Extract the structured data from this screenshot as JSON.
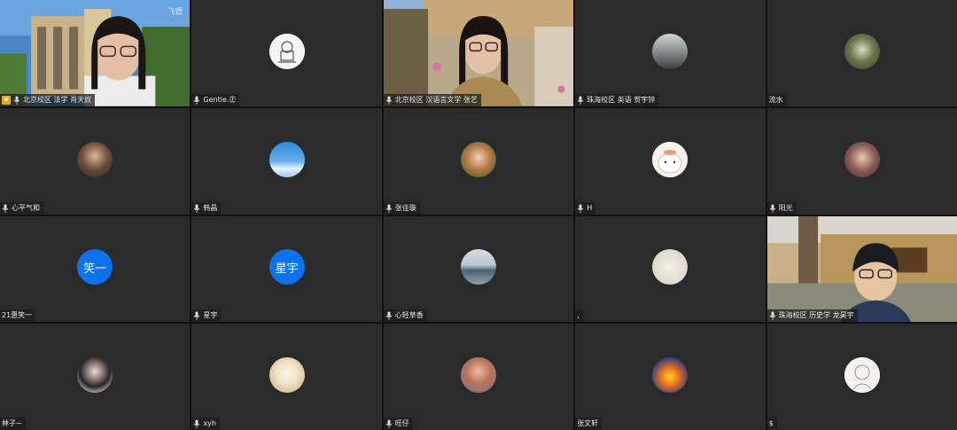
{
  "participants": [
    {
      "name": "北京校区 法学 肖天奴",
      "type": "video",
      "host": true
    },
    {
      "name": "Gentle.㊣",
      "type": "avatar",
      "avatar": "sketch-avatar"
    },
    {
      "name": "北京校区 汉语言文学 张艺",
      "type": "video"
    },
    {
      "name": "珠海校区 英语 贺宇锌",
      "type": "avatar",
      "avatar": "photo-avatar"
    },
    {
      "name": "流水",
      "type": "avatar",
      "avatar": "photo-avatar",
      "no_mic": true
    },
    {
      "name": "心平气和",
      "type": "avatar",
      "avatar": "photo-avatar"
    },
    {
      "name": "韩晶",
      "type": "avatar",
      "avatar": "sky-avatar"
    },
    {
      "name": "张佳璇",
      "type": "avatar",
      "avatar": "photo-avatar"
    },
    {
      "name": "H",
      "type": "avatar",
      "avatar": "cartoon-avatar"
    },
    {
      "name": "阳光",
      "type": "avatar",
      "avatar": "photo-avatar"
    },
    {
      "name": "21惠笑一",
      "type": "text-avatar",
      "initials": "笑一",
      "no_mic": true
    },
    {
      "name": "星宇",
      "type": "text-avatar",
      "initials": "星宇"
    },
    {
      "name": "心轻草香",
      "type": "avatar",
      "avatar": "lake-avatar"
    },
    {
      "name": ",",
      "type": "avatar",
      "avatar": "pale-avatar",
      "no_mic": true
    },
    {
      "name": "珠海校区 历史学 龙昊宇",
      "type": "video"
    },
    {
      "name": "林子~",
      "type": "avatar",
      "avatar": "photo-avatar",
      "no_mic": true
    },
    {
      "name": "xyh",
      "type": "avatar",
      "avatar": "duck-avatar"
    },
    {
      "name": "旺仔",
      "type": "avatar",
      "avatar": "photo-avatar"
    },
    {
      "name": "张文轩",
      "type": "avatar",
      "avatar": "fire-avatar",
      "no_mic": true
    },
    {
      "name": "$",
      "type": "avatar",
      "avatar": "drawing-avatar",
      "no_mic": true
    }
  ],
  "watermark": "飞镖",
  "colors": {
    "tile_bg": "#2a2a2b",
    "text_avatar_bg": "#0e72ed",
    "host_badge": "#f3a417"
  }
}
